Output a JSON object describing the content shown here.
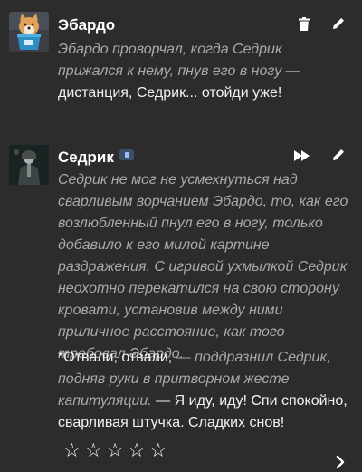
{
  "messages": [
    {
      "author": "Эбардо",
      "avatar_icon": "dog-in-bucket-avatar",
      "actions": [
        "trash-icon",
        "pencil-icon"
      ],
      "text_italic": "Эбардо проворчал, когда Седрик прижался к нему, пнув его в ногу",
      "text_speech": " — дистанция, Седрик... отойди уже!"
    },
    {
      "author": "Седрик",
      "avatar_icon": "dark-character-avatar",
      "badge_icon": "bot-badge-icon",
      "actions": [
        "fast-forward-icon",
        "pencil-icon"
      ],
      "paragraph1": "Седрик не мог не усмехнуться над сварливым ворчанием Эбардо, то, как его возлюбленный пнул его в ногу, только добавило к его милой картине раздражения. С игривой ухмылкой Седрик неохотно перекатился на свою сторону кровати, установив между ними приличное расстояние, как того требовал Эбардо.",
      "p2_speech_a": "*Отвали, отвали,",
      "p2_italic": " — поддразнил Седрик, подняв руки в притворном жесте капитуляции.",
      "p2_speech_b": " — Я иду, иду! Спи спокойно, сварливая штучка. Сладких снов!",
      "rating": {
        "max": 5,
        "value": 0,
        "star_char": "☆"
      }
    }
  ],
  "next_icon": "chevron-right-icon"
}
